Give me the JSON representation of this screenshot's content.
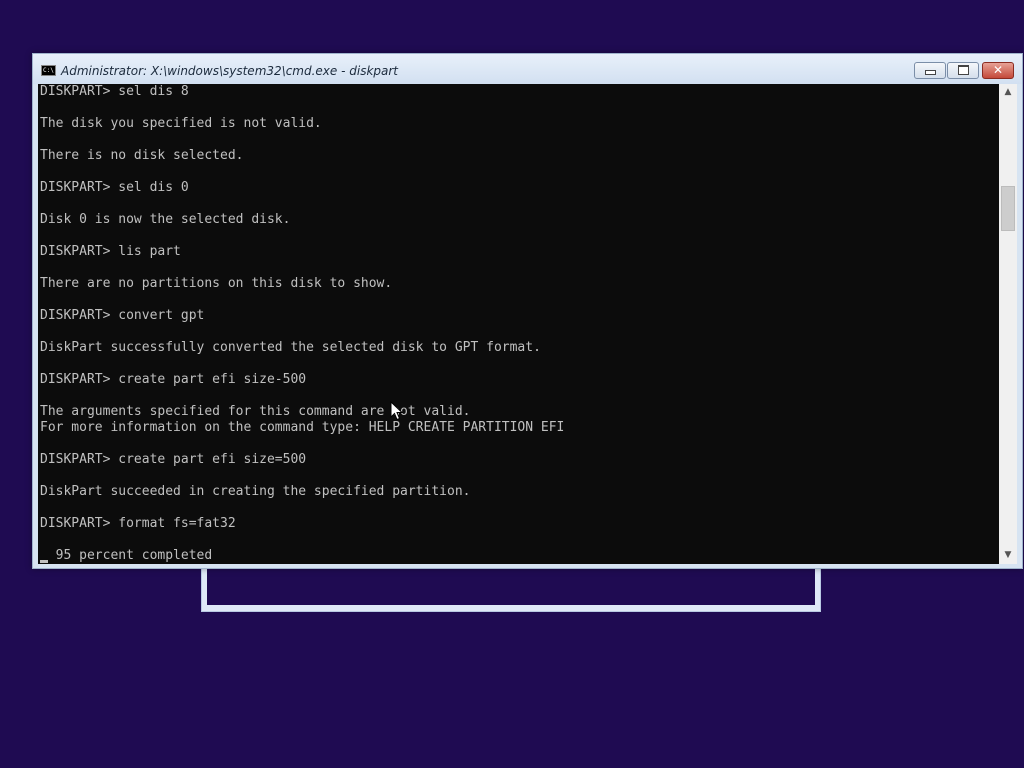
{
  "desktop": {
    "background_color": "#1f0b52"
  },
  "window": {
    "title": "Administrator: X:\\windows\\system32\\cmd.exe - diskpart",
    "icon": "cmd-icon",
    "icon_text": "C:\\",
    "minimize_icon": "minimize-icon",
    "maximize_icon": "maximize-icon",
    "close_icon": "close-icon",
    "close_glyph": "✕"
  },
  "console": {
    "background": "#0c0c0c",
    "foreground": "#c0c0c0",
    "lines": [
      "DISKPART> sel dis 8",
      "",
      "The disk you specified is not valid.",
      "",
      "There is no disk selected.",
      "",
      "DISKPART> sel dis 0",
      "",
      "Disk 0 is now the selected disk.",
      "",
      "DISKPART> lis part",
      "",
      "There are no partitions on this disk to show.",
      "",
      "DISKPART> convert gpt",
      "",
      "DiskPart successfully converted the selected disk to GPT format.",
      "",
      "DISKPART> create part efi size-500",
      "",
      "The arguments specified for this command are not valid.",
      "For more information on the command type: HELP CREATE PARTITION EFI",
      "",
      "DISKPART> create part efi size=500",
      "",
      "DiskPart succeeded in creating the specified partition.",
      "",
      "DISKPART> format fs=fat32",
      "",
      "  95 percent completed"
    ]
  },
  "scrollbar": {
    "up_arrow": "▲",
    "down_arrow": "▼",
    "up_icon": "scroll-up-arrow-icon",
    "down_icon": "scroll-down-arrow-icon"
  }
}
